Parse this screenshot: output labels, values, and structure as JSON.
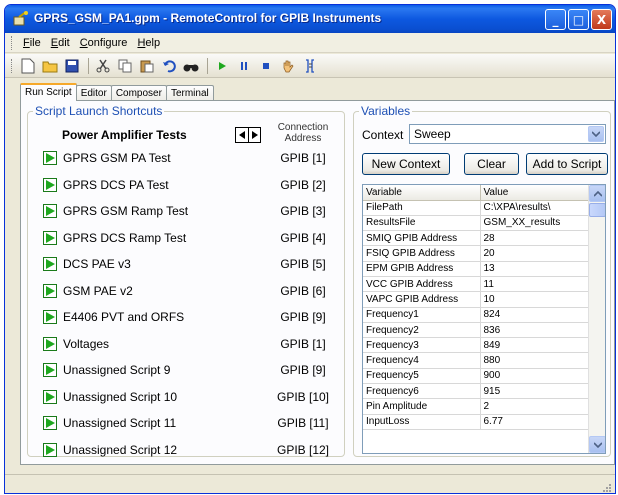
{
  "window": {
    "title": "GPRS_GSM_PA1.gpm - RemoteControl for GPIB Instruments",
    "min_label": "_",
    "max_label": "□",
    "close_label": "X"
  },
  "menu": {
    "items": [
      {
        "label": "File"
      },
      {
        "label": "Edit"
      },
      {
        "label": "Configure"
      },
      {
        "label": "Help"
      }
    ]
  },
  "toolbar": {
    "icons": [
      "new-file-icon",
      "open-folder-icon",
      "save-icon",
      "cut-icon",
      "copy-icon",
      "paste-icon",
      "undo-icon",
      "find-icon",
      "play-icon",
      "pause-icon",
      "stop-icon",
      "hand-icon",
      "insert-icon"
    ]
  },
  "tabs": [
    {
      "label": "Run Script",
      "active": true
    },
    {
      "label": "Editor",
      "active": false
    },
    {
      "label": "Composer",
      "active": false
    },
    {
      "label": "Terminal",
      "active": false
    }
  ],
  "launch": {
    "group_title": "Script Launch Shortcuts",
    "section_title": "Power Amplifier Tests",
    "conn_header_line1": "Connection",
    "conn_header_line2": "Address",
    "scripts": [
      {
        "name": "GPRS GSM PA Test",
        "address": "GPIB [1]"
      },
      {
        "name": "GPRS DCS PA Test",
        "address": "GPIB [2]"
      },
      {
        "name": "GPRS GSM Ramp Test",
        "address": "GPIB [3]"
      },
      {
        "name": "GPRS DCS Ramp Test",
        "address": "GPIB [4]"
      },
      {
        "name": "DCS PAE v3",
        "address": "GPIB [5]"
      },
      {
        "name": "GSM PAE v2",
        "address": "GPIB [6]"
      },
      {
        "name": "E4406 PVT and ORFS",
        "address": "GPIB [9]"
      },
      {
        "name": "Voltages",
        "address": "GPIB [1]"
      },
      {
        "name": "Unassigned Script 9",
        "address": "GPIB [9]"
      },
      {
        "name": "Unassigned Script 10",
        "address": "GPIB [10]"
      },
      {
        "name": "Unassigned Script 11",
        "address": "GPIB [11]"
      },
      {
        "name": "Unassigned Script 12",
        "address": "GPIB [12]"
      }
    ]
  },
  "variables": {
    "group_title": "Variables",
    "context_label": "Context",
    "context_value": "Sweep",
    "buttons": {
      "new_context": "New Context",
      "clear": "Clear",
      "add_to_script": "Add to Script"
    },
    "columns": [
      "Variable",
      "Value"
    ],
    "rows": [
      {
        "name": "FilePath",
        "value": "C:\\XPA\\results\\"
      },
      {
        "name": "ResultsFile",
        "value": "GSM_XX_results"
      },
      {
        "name": "SMIQ GPIB Address",
        "value": "28"
      },
      {
        "name": "FSIQ GPIB Address",
        "value": "20"
      },
      {
        "name": "EPM GPIB Address",
        "value": "13"
      },
      {
        "name": "VCC GPIB Address",
        "value": "11"
      },
      {
        "name": "VAPC GPIB Address",
        "value": "10"
      },
      {
        "name": "Frequency1",
        "value": "824"
      },
      {
        "name": "Frequency2",
        "value": "836"
      },
      {
        "name": "Frequency3",
        "value": "849"
      },
      {
        "name": "Frequency4",
        "value": "880"
      },
      {
        "name": "Frequency5",
        "value": "900"
      },
      {
        "name": "Frequency6",
        "value": "915"
      },
      {
        "name": "Pin Amplitude",
        "value": "2"
      },
      {
        "name": "InputLoss",
        "value": "6.77"
      }
    ]
  },
  "colors": {
    "titlebar": "#0a5ce8",
    "group_label": "#1e50b4",
    "play_green": "#1fa81f"
  }
}
